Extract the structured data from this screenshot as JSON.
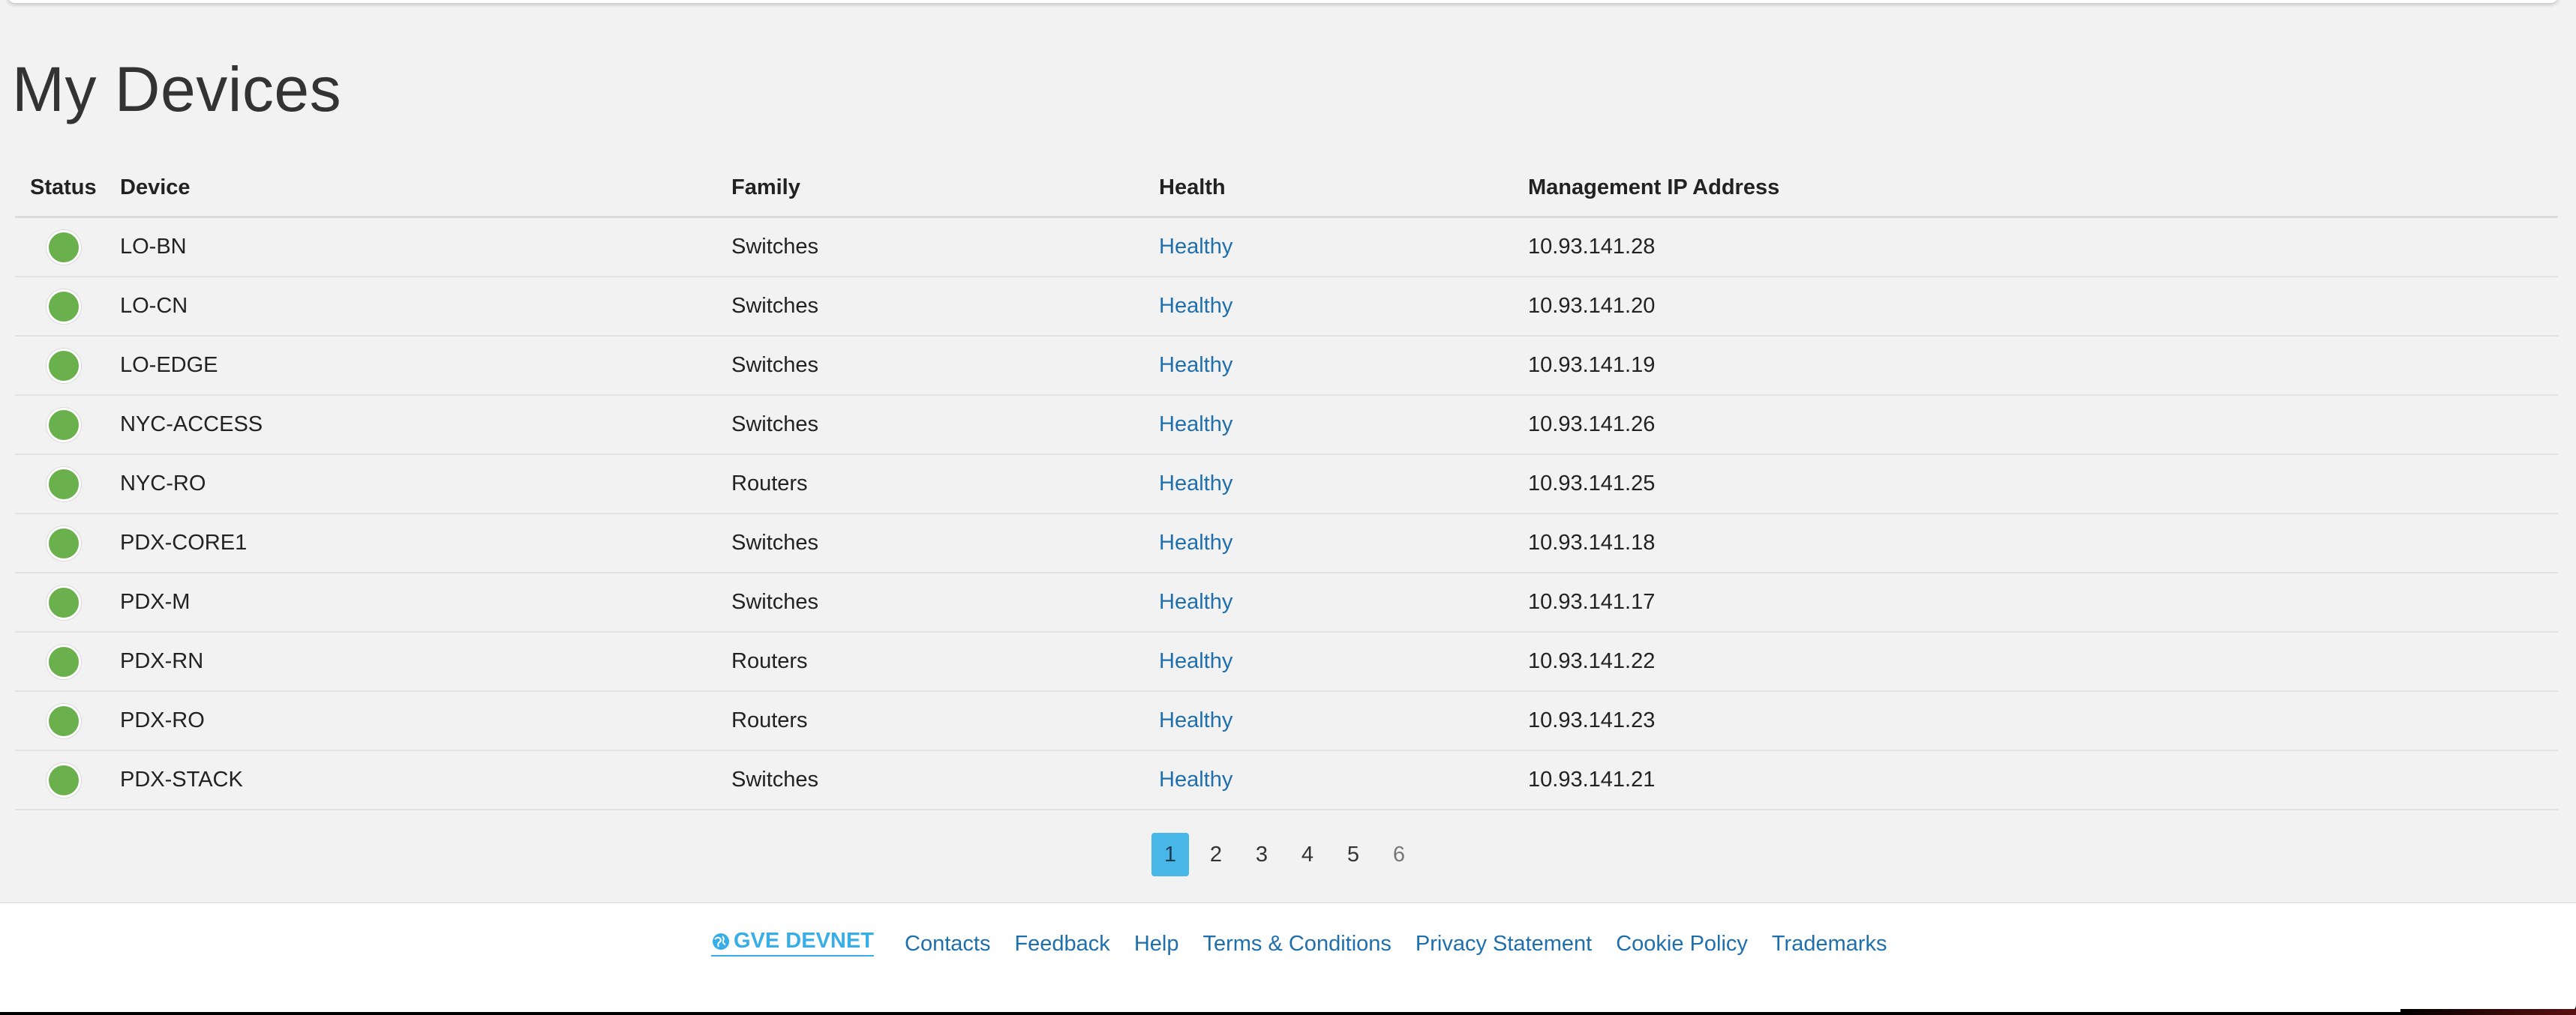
{
  "page": {
    "title": "My Devices"
  },
  "table": {
    "columns": [
      "Status",
      "Device",
      "Family",
      "Health",
      "Management IP Address"
    ],
    "rows": [
      {
        "status": "up",
        "device": "LO-BN",
        "family": "Switches",
        "health": "Healthy",
        "ip": "10.93.141.28"
      },
      {
        "status": "up",
        "device": "LO-CN",
        "family": "Switches",
        "health": "Healthy",
        "ip": "10.93.141.20"
      },
      {
        "status": "up",
        "device": "LO-EDGE",
        "family": "Switches",
        "health": "Healthy",
        "ip": "10.93.141.19"
      },
      {
        "status": "up",
        "device": "NYC-ACCESS",
        "family": "Switches",
        "health": "Healthy",
        "ip": "10.93.141.26"
      },
      {
        "status": "up",
        "device": "NYC-RO",
        "family": "Routers",
        "health": "Healthy",
        "ip": "10.93.141.25"
      },
      {
        "status": "up",
        "device": "PDX-CORE1",
        "family": "Switches",
        "health": "Healthy",
        "ip": "10.93.141.18"
      },
      {
        "status": "up",
        "device": "PDX-M",
        "family": "Switches",
        "health": "Healthy",
        "ip": "10.93.141.17"
      },
      {
        "status": "up",
        "device": "PDX-RN",
        "family": "Routers",
        "health": "Healthy",
        "ip": "10.93.141.22"
      },
      {
        "status": "up",
        "device": "PDX-RO",
        "family": "Routers",
        "health": "Healthy",
        "ip": "10.93.141.23"
      },
      {
        "status": "up",
        "device": "PDX-STACK",
        "family": "Switches",
        "health": "Healthy",
        "ip": "10.93.141.21"
      }
    ]
  },
  "pagination": {
    "pages": [
      "1",
      "2",
      "3",
      "4",
      "5",
      "6"
    ],
    "current": "1"
  },
  "footer": {
    "logo_text": "GVE DEVNET",
    "logo_icon": "globe-icon",
    "links": [
      "Contacts",
      "Feedback",
      "Help",
      "Terms & Conditions",
      "Privacy Statement",
      "Cookie Policy",
      "Trademarks"
    ]
  },
  "colors": {
    "status_up": "#6ab04c",
    "link": "#1f6fad",
    "active_page": "#49b6e8",
    "logo": "#39aee6",
    "background": "#f2f2f2"
  }
}
